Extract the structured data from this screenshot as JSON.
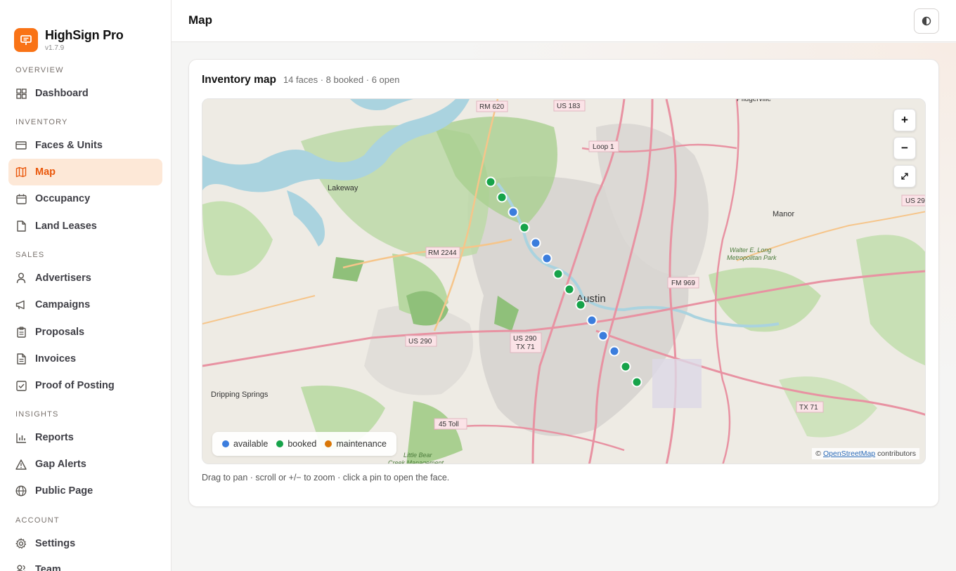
{
  "app": {
    "name": "HighSign Pro",
    "version": "v1.7.9"
  },
  "sidebar": {
    "sections": [
      {
        "label": "OVERVIEW",
        "items": [
          {
            "label": "Dashboard",
            "icon": "grid-icon"
          }
        ]
      },
      {
        "label": "INVENTORY",
        "items": [
          {
            "label": "Faces & Units",
            "icon": "billboard-icon"
          },
          {
            "label": "Map",
            "icon": "map-icon",
            "active": true
          },
          {
            "label": "Occupancy",
            "icon": "calendar-icon"
          },
          {
            "label": "Land Leases",
            "icon": "file-icon"
          }
        ]
      },
      {
        "label": "SALES",
        "items": [
          {
            "label": "Advertisers",
            "icon": "user-icon"
          },
          {
            "label": "Campaigns",
            "icon": "megaphone-icon"
          },
          {
            "label": "Proposals",
            "icon": "clipboard-icon"
          },
          {
            "label": "Invoices",
            "icon": "invoice-icon"
          },
          {
            "label": "Proof of Posting",
            "icon": "check-square-icon"
          }
        ]
      },
      {
        "label": "INSIGHTS",
        "items": [
          {
            "label": "Reports",
            "icon": "bar-chart-icon"
          },
          {
            "label": "Gap Alerts",
            "icon": "alert-triangle-icon"
          },
          {
            "label": "Public Page",
            "icon": "globe-icon"
          }
        ]
      },
      {
        "label": "ACCOUNT",
        "items": [
          {
            "label": "Settings",
            "icon": "gear-icon"
          },
          {
            "label": "Team",
            "icon": "users-icon"
          }
        ]
      }
    ]
  },
  "header": {
    "title": "Map",
    "theme_toggle_icon": "contrast-icon"
  },
  "card": {
    "title": "Inventory map",
    "subtitle": "14 faces · 8 booked · 6 open",
    "hint": "Drag to pan · scroll or +/− to zoom · click a pin to open the face."
  },
  "map": {
    "zoom_in": "+",
    "zoom_out": "−",
    "fullscreen_icon": "expand-icon",
    "legend": [
      {
        "label": "available",
        "color": "#3b7ddd"
      },
      {
        "label": "booked",
        "color": "#16a34a"
      },
      {
        "label": "maintenance",
        "color": "#d97706"
      }
    ],
    "attribution": {
      "prefix": "©",
      "link": "OpenStreetMap",
      "suffix": "contributors"
    },
    "place_labels": [
      {
        "text": "Lakeway"
      },
      {
        "text": "Austin"
      },
      {
        "text": "Manor"
      },
      {
        "text": "Dripping Springs"
      },
      {
        "text": "Walter E. Long Metropolitan Park"
      },
      {
        "text": "Little Bear Creek Management"
      },
      {
        "text": "Pflugerville"
      }
    ],
    "road_shields": [
      "RM 620",
      "US 183",
      "Loop 1",
      "RM 2244",
      "US 290",
      "US 290 TX 71",
      "FM 969",
      "45 Toll",
      "TX 71",
      "US 29"
    ],
    "pins": [
      {
        "status": "booked"
      },
      {
        "status": "booked"
      },
      {
        "status": "available"
      },
      {
        "status": "booked"
      },
      {
        "status": "available"
      },
      {
        "status": "available"
      },
      {
        "status": "booked"
      },
      {
        "status": "booked"
      },
      {
        "status": "booked"
      },
      {
        "status": "available"
      },
      {
        "status": "available"
      },
      {
        "status": "available"
      },
      {
        "status": "booked"
      },
      {
        "status": "booked"
      }
    ]
  }
}
